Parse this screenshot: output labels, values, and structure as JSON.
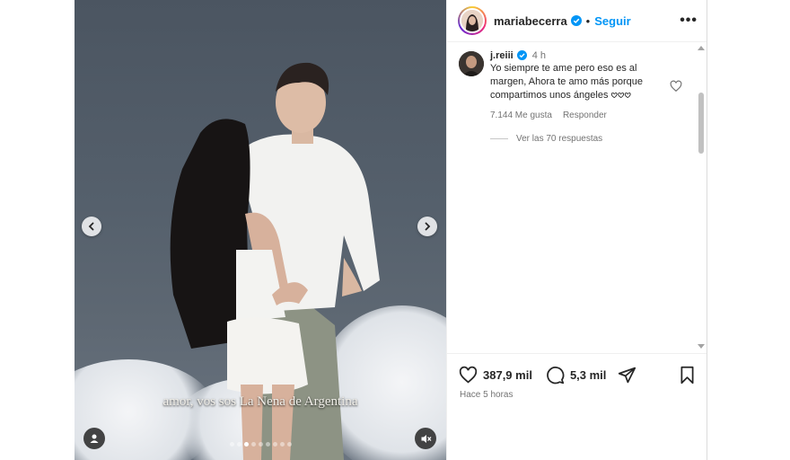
{
  "post": {
    "caption": "amor, vos sos La Nena de Argentina",
    "slide_count": 9,
    "active_slide": 3
  },
  "header": {
    "username": "mariabecerra",
    "separator": "•",
    "follow_label": "Seguir",
    "more_label": "•••"
  },
  "comment": {
    "username": "j.reiii",
    "time": "4 h",
    "text": "Yo siempre te ame pero eso es al margen, Ahora te amo más porque compartimos unos ángeles 𖹭𖹭𖹭",
    "likes": "7.144 Me gusta",
    "reply_label": "Responder",
    "view_replies": "Ver las 70 respuestas"
  },
  "stats": {
    "likes": "387,9 mil",
    "comments": "5,3 mil",
    "posted": "Hace 5 horas"
  },
  "colors": {
    "accent": "#0095f6",
    "verified": "#0095f6",
    "muted": "#737373"
  }
}
